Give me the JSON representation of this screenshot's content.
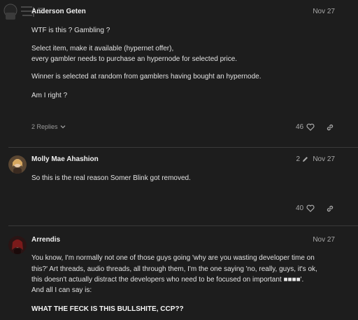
{
  "posts": [
    {
      "author": "Anderson Geten",
      "date": "Nov 27",
      "lines": [
        "WTF is this ? Gambling ?",
        "Select item, make it available (hypernet offer),",
        "every gambler needs to purchase an hypernode for selected price.",
        "Winner is selected at random from gamblers having bought an hypernode.",
        "Am I right ?"
      ],
      "replies_label": "2 Replies",
      "likes": "46"
    },
    {
      "author": "Molly Mae Ahashion",
      "date": "Nov 27",
      "edit_count": "2",
      "lines": [
        "So this is the real reason Somer Blink got removed."
      ],
      "likes": "40"
    },
    {
      "author": "Arrendis",
      "date": "Nov 27",
      "lines": [
        "You know, I'm normally not one of those guys going 'why are you wasting developer time on",
        "this?' Art threads, audio threads, all through them, I'm the one saying 'no, really, guys, it's ok,",
        "this doesn't actually distract the developers who need to be focused on important ■■■■'.",
        "And all I can say is:",
        "WHAT THE FECK IS THIS BULLSHITE, CCP??"
      ]
    }
  ],
  "icons": {
    "heart": "heart-icon",
    "link": "link-icon",
    "pencil": "pencil-icon",
    "chevron": "chevron-down-icon"
  }
}
